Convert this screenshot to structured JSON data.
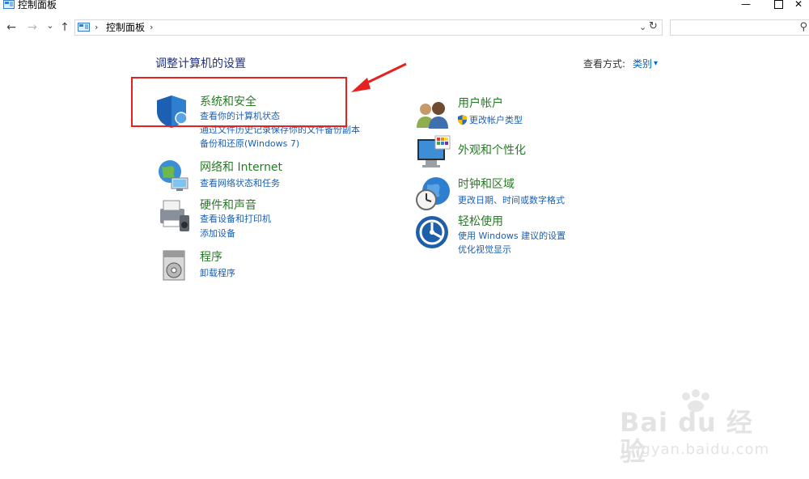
{
  "window": {
    "title": "控制面板",
    "minimize_glyph": "—",
    "close_glyph": "✕"
  },
  "nav": {
    "back_glyph": "←",
    "forward_glyph": "→",
    "recent_glyph": "⌄",
    "up_glyph": "↑",
    "breadcrumb_sep1": "›",
    "breadcrumb_location": "控制面板",
    "breadcrumb_sep2": "›",
    "dropdown_glyph": "⌄",
    "refresh_glyph": "↻",
    "search_glyph": "⚲",
    "search_placeholder": ""
  },
  "header": {
    "page_title": "调整计算机的设置",
    "view_by_label": "查看方式:",
    "view_by_value": "类别",
    "view_by_caret": "▾"
  },
  "categories_left": [
    {
      "title": "系统和安全",
      "links": [
        "查看你的计算机状态",
        "通过文件历史记录保存你的文件备份副本",
        "备份和还原(Windows 7)"
      ]
    },
    {
      "title": "网络和 Internet",
      "links": [
        "查看网络状态和任务"
      ]
    },
    {
      "title": "硬件和声音",
      "links": [
        "查看设备和打印机",
        "添加设备"
      ]
    },
    {
      "title": "程序",
      "links": [
        "卸载程序"
      ]
    }
  ],
  "categories_right": [
    {
      "title": "用户帐户",
      "links": [
        "更改帐户类型"
      ]
    },
    {
      "title": "外观和个性化",
      "links": []
    },
    {
      "title": "时钟和区域",
      "links": [
        "更改日期、时间或数字格式"
      ]
    },
    {
      "title": "轻松使用",
      "links": [
        "使用 Windows 建议的设置",
        "优化视觉显示"
      ]
    }
  ],
  "annotation": {
    "highlight_color": "#e52222"
  },
  "watermark": {
    "text": "Bai du 经验",
    "sub": "jingyan.baidu.com"
  },
  "colors": {
    "category_title": "#267c26",
    "link": "#1a5fb4",
    "page_title": "#1e3287"
  }
}
